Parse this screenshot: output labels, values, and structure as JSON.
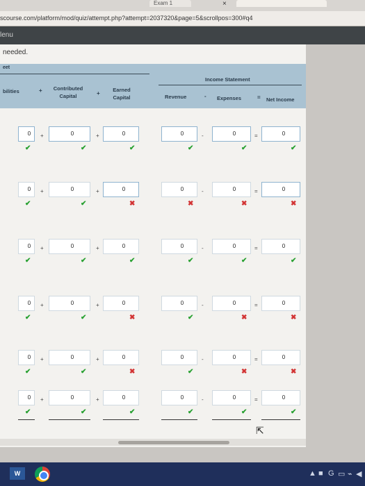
{
  "browser": {
    "tab_exam": "Exam 1",
    "tab_close": "×",
    "tab_active": "",
    "url": "scourse.com/platform/mod/quiz/attempt.php?attempt=2037320&page=5&scrollpos=300#q4"
  },
  "menu": {
    "label": "lenu"
  },
  "note": "needed.",
  "header": {
    "bs_title": "eet",
    "is_title": "Income Statement",
    "columns": {
      "liabilities": "bilities",
      "contributed": [
        "Contributed",
        "Capital"
      ],
      "earned": [
        "Earned",
        "Capital"
      ],
      "revenue": "Revenue",
      "expenses": "Expenses",
      "net_income": "Net Income"
    },
    "operators": {
      "plus1": "+",
      "plus2": "+",
      "minus": "-",
      "equals": "="
    }
  },
  "rows": [
    {
      "values": [
        "0",
        "0",
        "0",
        "0",
        "0",
        "0"
      ],
      "marks": [
        "ok",
        "ok",
        "ok",
        "ok",
        "ok",
        "ok"
      ],
      "boxed": [
        true,
        true,
        true,
        true,
        true,
        true
      ]
    },
    {
      "values": [
        "0",
        "0",
        "0",
        "0",
        "0",
        "0"
      ],
      "marks": [
        "ok",
        "ok",
        "bad",
        "bad",
        "bad",
        "bad"
      ],
      "boxed": [
        false,
        false,
        true,
        false,
        false,
        true
      ]
    },
    {
      "values": [
        "0",
        "0",
        "0",
        "0",
        "0",
        "0"
      ],
      "marks": [
        "ok",
        "ok",
        "ok",
        "ok",
        "ok",
        "ok"
      ],
      "boxed": [
        false,
        false,
        false,
        false,
        false,
        false
      ]
    },
    {
      "values": [
        "0",
        "0",
        "0",
        "0",
        "0",
        "0"
      ],
      "marks": [
        "ok",
        "ok",
        "bad",
        "ok",
        "bad",
        "bad"
      ],
      "boxed": [
        false,
        false,
        false,
        false,
        false,
        false
      ]
    },
    {
      "values": [
        "0",
        "0",
        "0",
        "0",
        "0",
        "0"
      ],
      "marks": [
        "ok",
        "ok",
        "bad",
        "ok",
        "bad",
        "bad"
      ],
      "boxed": [
        false,
        false,
        false,
        false,
        false,
        false
      ]
    },
    {
      "values": [
        "0",
        "0",
        "0",
        "0",
        "0",
        "0"
      ],
      "marks": [
        "ok",
        "ok",
        "ok",
        "ok",
        "ok",
        "ok"
      ],
      "boxed": [
        false,
        false,
        false,
        false,
        false,
        false
      ]
    }
  ],
  "mark_symbols": {
    "ok": "✔",
    "bad": "✖"
  },
  "cursor": "⇱",
  "taskbar": {
    "word": "W",
    "tray_icons": [
      "▲",
      "■",
      "G",
      "▭",
      "⌁",
      "◀"
    ]
  }
}
